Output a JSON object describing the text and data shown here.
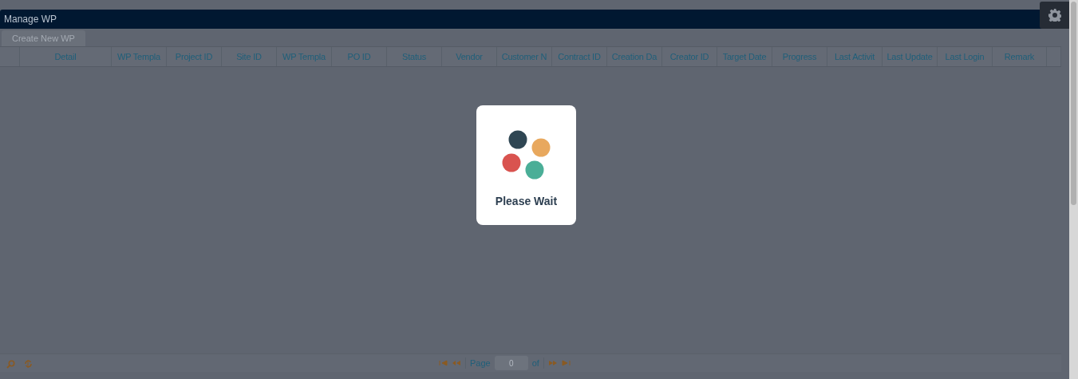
{
  "window": {
    "title": "Manage WP"
  },
  "toolbar": {
    "create_button": "Create New WP"
  },
  "table": {
    "columns": [
      "",
      "Detail",
      "WP Templa",
      "Project ID",
      "Site ID",
      "WP Templa",
      "PO ID",
      "Status",
      "Vendor",
      "Customer N",
      "Contract ID",
      "Creation Da",
      "Creator ID",
      "Target Date",
      "Progress",
      "Last Activit",
      "Last Update",
      "Last Login",
      "Remark",
      ""
    ]
  },
  "pager": {
    "page_label": "Page",
    "page_value": "0",
    "of_label": "of"
  },
  "loading": {
    "message": "Please Wait",
    "dots": [
      {
        "color": "#2f4653"
      },
      {
        "color": "#e8a85e"
      },
      {
        "color": "#d9534f"
      },
      {
        "color": "#4aae97"
      }
    ]
  }
}
